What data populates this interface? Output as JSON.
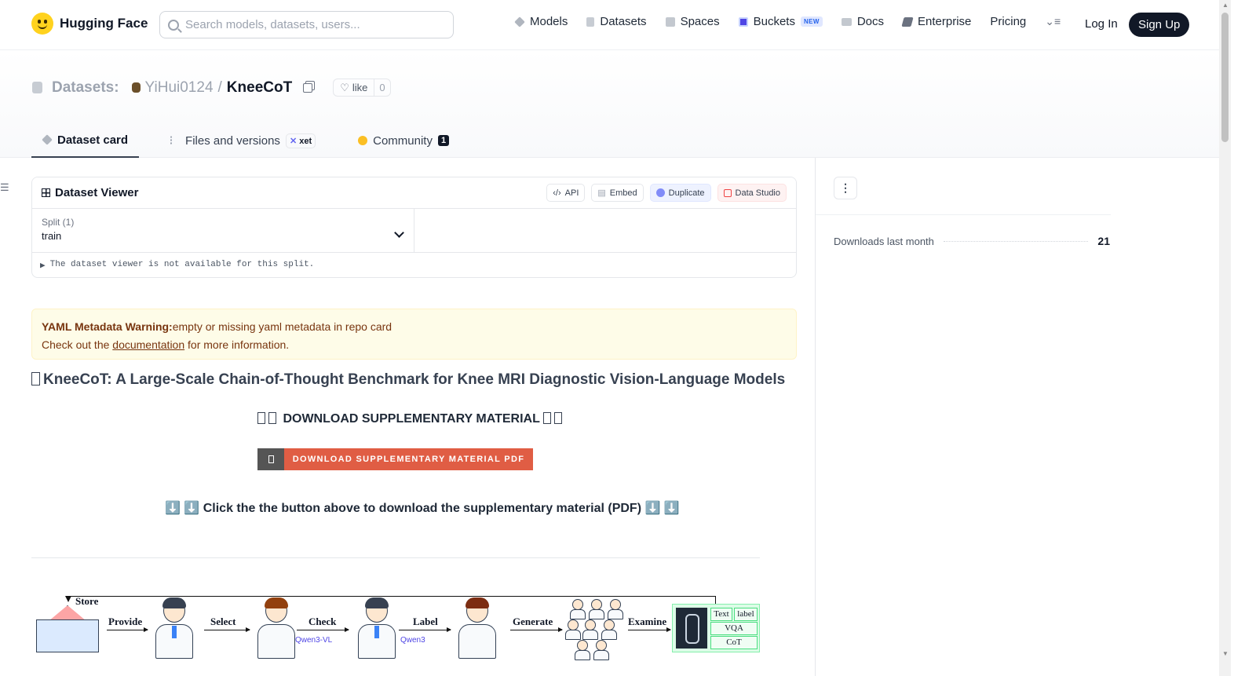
{
  "header": {
    "brand": "Hugging Face",
    "search_placeholder": "Search models, datasets, users...",
    "nav": [
      {
        "label": "Models",
        "icon": "cube-icon",
        "color": "#9ca3af"
      },
      {
        "label": "Datasets",
        "icon": "database-icon",
        "color": "#c7ccd3"
      },
      {
        "label": "Spaces",
        "icon": "grid-icon",
        "color": "#b6bcc5"
      },
      {
        "label": "Buckets",
        "icon": "bucket-icon",
        "color": "#4f46e5",
        "badge": "NEW"
      },
      {
        "label": "Docs",
        "icon": "book-icon",
        "color": "#b6bcc5"
      },
      {
        "label": "Enterprise",
        "icon": "enterprise-icon",
        "color": "#6b7280"
      },
      {
        "label": "Pricing"
      }
    ],
    "login": "Log In",
    "signup": "Sign Up"
  },
  "repo": {
    "section": "Datasets:",
    "owner": "YiHui0124",
    "name": "KneeCoT",
    "like_label": "like",
    "like_count": "0"
  },
  "tabs": [
    {
      "label": "Dataset card",
      "active": true
    },
    {
      "label": "Files and versions",
      "badge": "xet"
    },
    {
      "label": "Community",
      "count": "1"
    }
  ],
  "viewer": {
    "title": "Dataset Viewer",
    "actions": [
      "API",
      "Embed",
      "Duplicate",
      "Data Studio"
    ],
    "split_label": "Split (1)",
    "split_value": "train",
    "note": "The dataset viewer is not available for this split."
  },
  "warning": {
    "title": "YAML Metadata Warning:",
    "message": "empty or missing yaml metadata in repo card",
    "line2_prefix": "Check out the",
    "link": "documentation",
    "line2_suffix": "for more information."
  },
  "card": {
    "heading": "KneeCoT: A Large-Scale Chain-of-Thought Benchmark for Knee MRI Diagnostic Vision-Language Models",
    "download_heading": "DOWNLOAD SUPPLEMENTARY MATERIAL",
    "download_button": "DOWNLOAD SUPPLEMENTARY MATERIAL PDF",
    "click_note": "⬇️ ⬇️ Click the the button above to download the supplementary material (PDF) ⬇️ ⬇️"
  },
  "figure": {
    "store": "Store",
    "steps": [
      "Provide",
      "Select",
      "Check",
      "Label",
      "Generate",
      "Examine"
    ],
    "models": [
      "Qwen3-VL",
      "Qwen3"
    ],
    "result_labels": [
      "Text",
      "label",
      "VQA",
      "CoT"
    ]
  },
  "sidebar": {
    "downloads_label": "Downloads last month",
    "downloads_value": "21"
  }
}
